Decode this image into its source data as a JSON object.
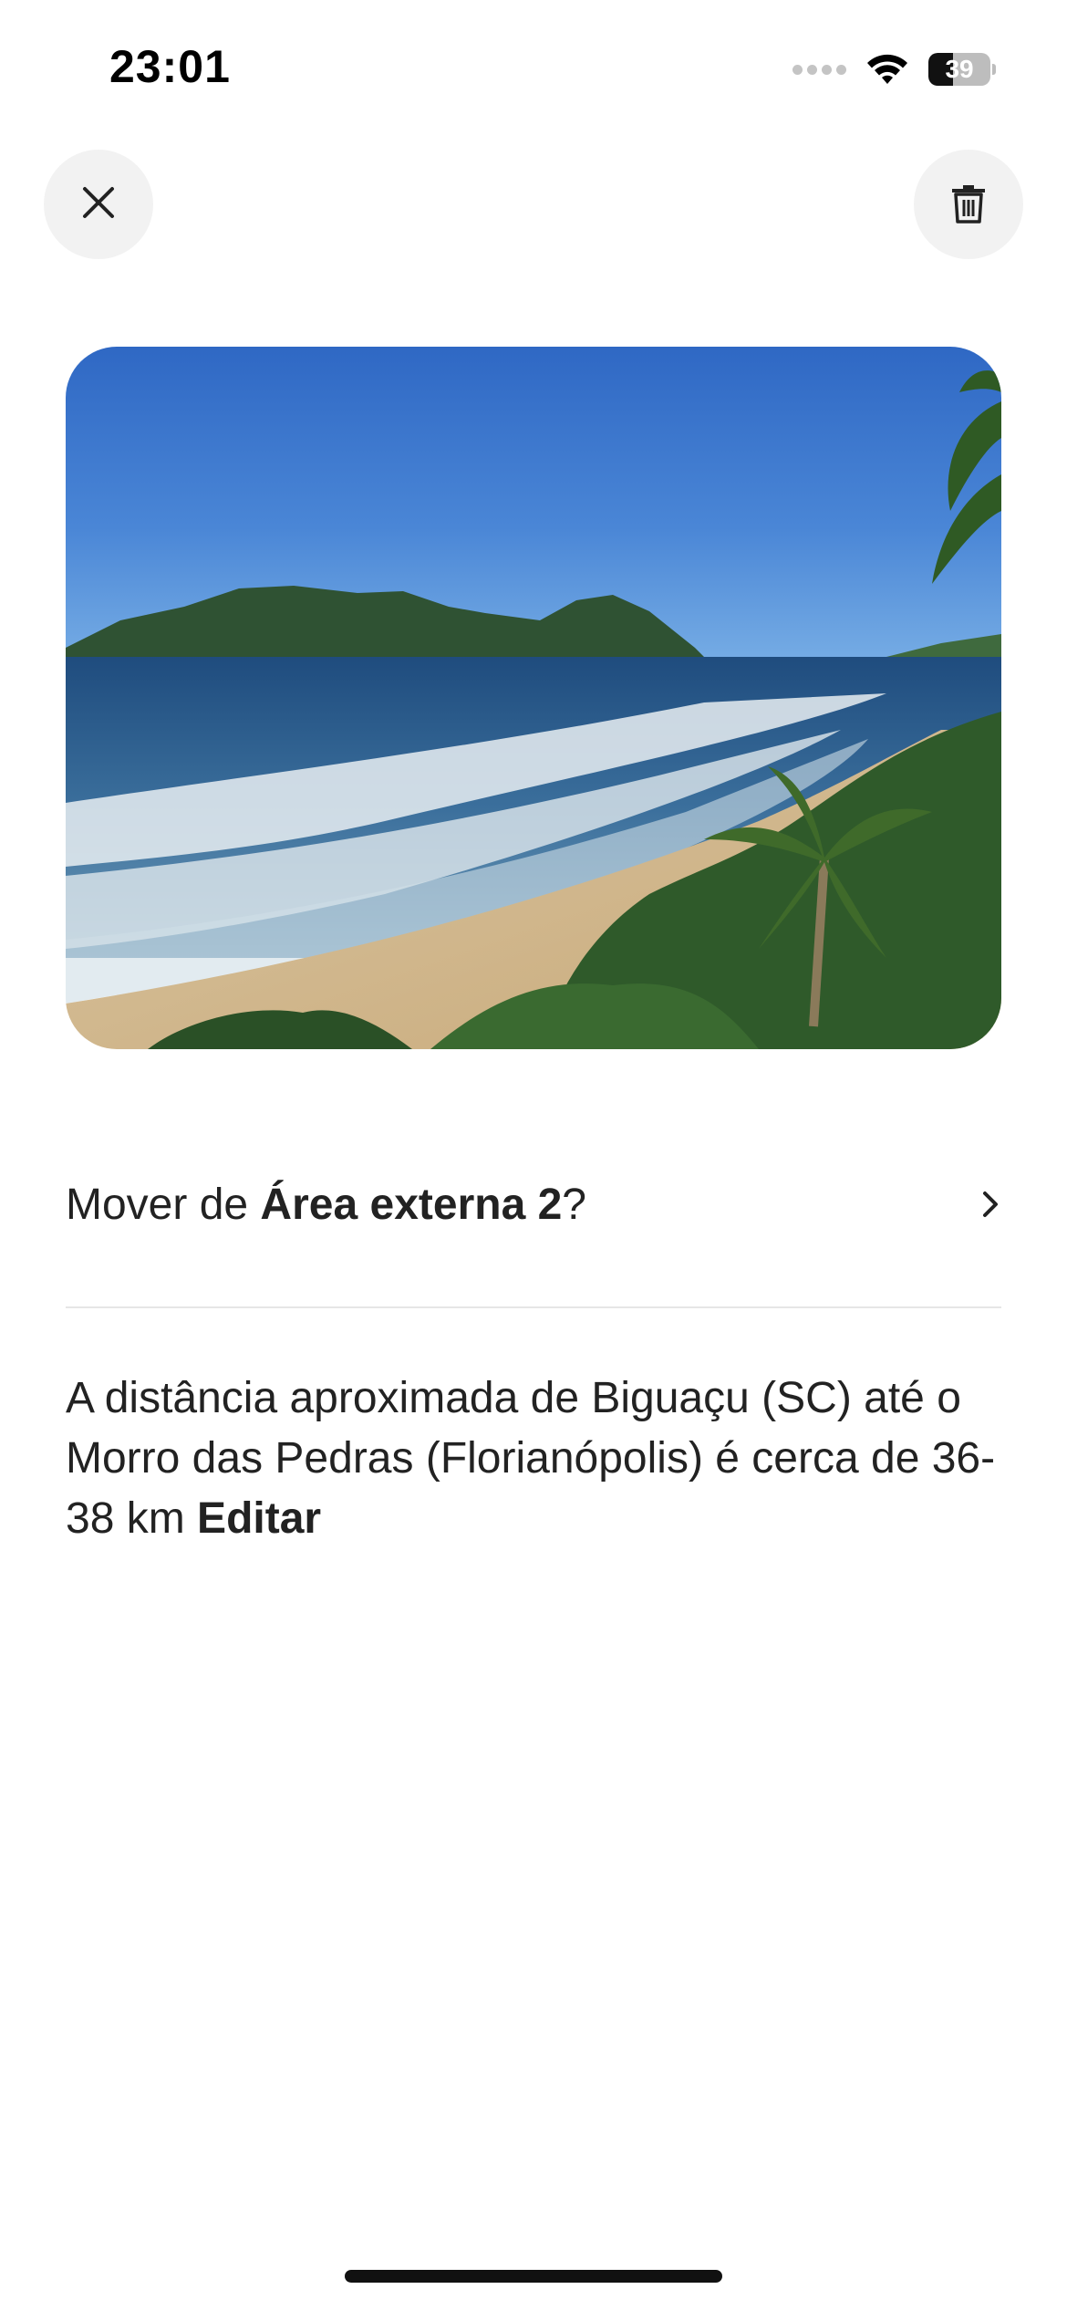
{
  "status_bar": {
    "time": "23:01",
    "battery_level": "39",
    "battery_fraction": 0.39
  },
  "header": {
    "close_icon": "close-icon",
    "delete_icon": "trash-icon"
  },
  "photo": {
    "description_icon": "beach-photo"
  },
  "move_row": {
    "prefix": "Mover de ",
    "area_name": "Área externa 2",
    "suffix": "?",
    "chevron_icon": "chevron-right-icon"
  },
  "description": {
    "text": "A distância aproximada de Biguaçu (SC) até o Morro das Pedras (Florianópolis) é cerca de 36-38 km ",
    "edit_label": "Editar"
  },
  "colors": {
    "button_bg": "#f2f2f2",
    "text": "#222222",
    "divider": "#e6e6e6"
  }
}
